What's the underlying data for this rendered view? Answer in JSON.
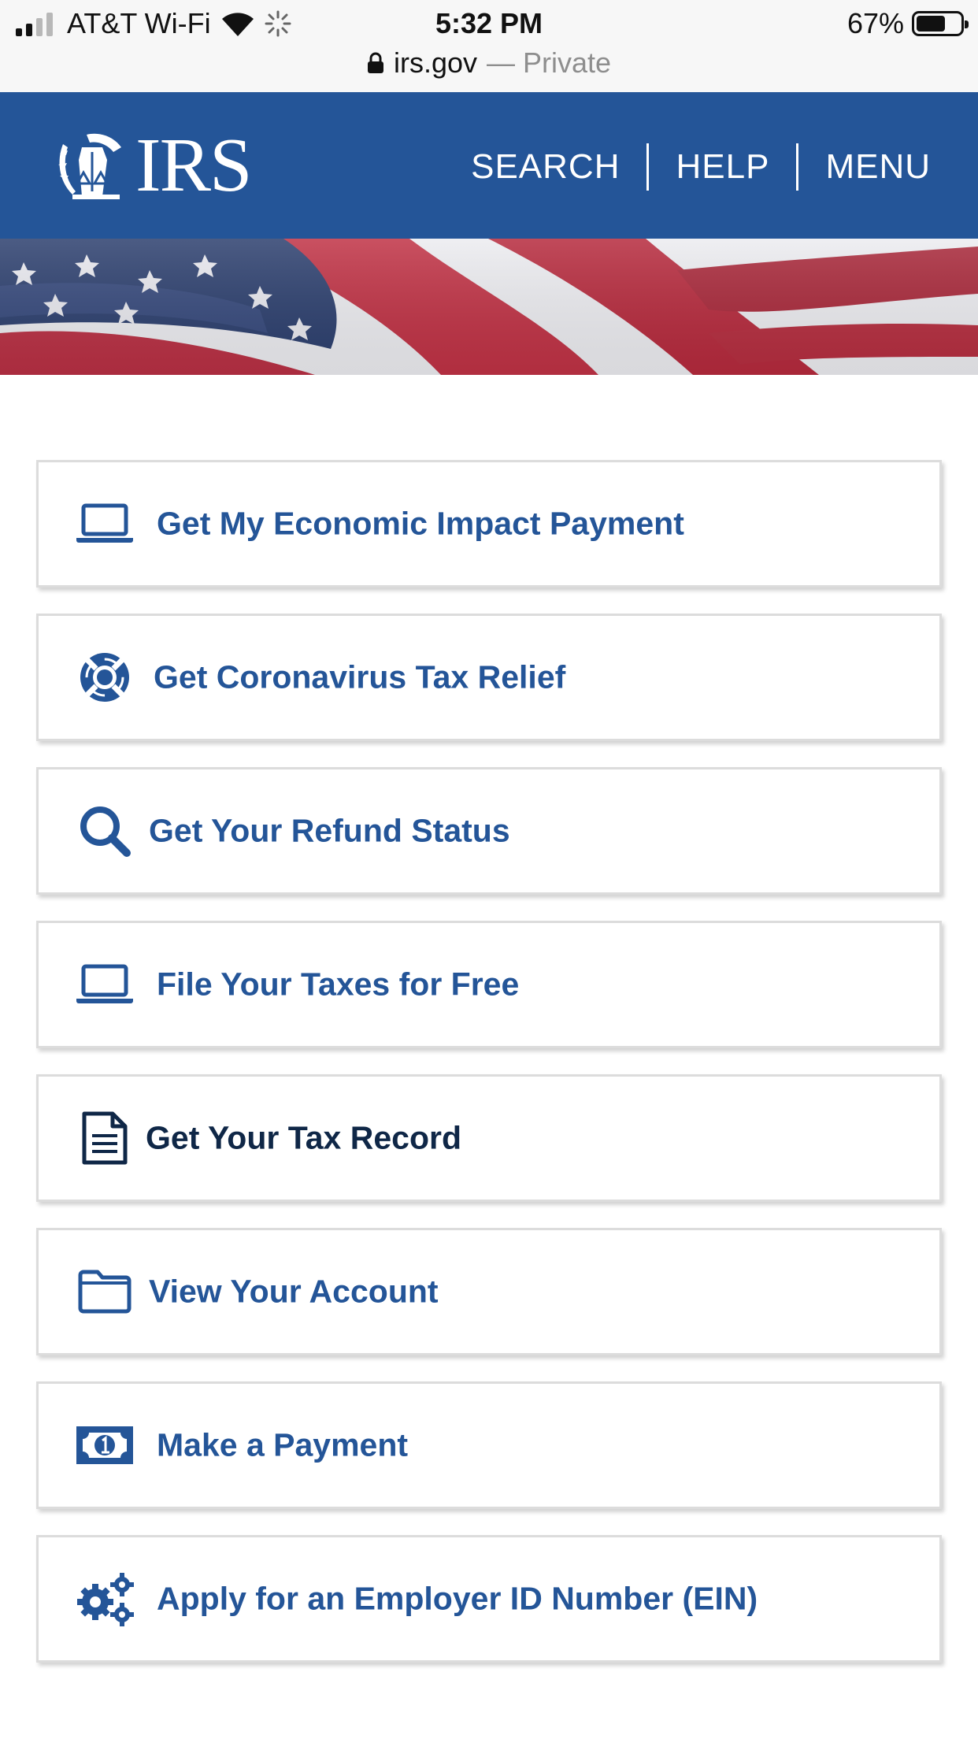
{
  "status_bar": {
    "carrier": "AT&T Wi-Fi",
    "time": "5:32 PM",
    "battery_percent": "67%",
    "battery_level": 0.67
  },
  "url_bar": {
    "domain": "irs.gov",
    "mode": "— Private"
  },
  "header": {
    "logo_text": "IRS",
    "nav": [
      "SEARCH",
      "HELP",
      "MENU"
    ],
    "background_color": "#245598"
  },
  "actions": [
    {
      "label": "Get My Economic Impact Payment",
      "icon": "laptop-icon"
    },
    {
      "label": "Get Coronavirus Tax Relief",
      "icon": "lifebuoy-icon"
    },
    {
      "label": "Get Your Refund Status",
      "icon": "search-icon"
    },
    {
      "label": "File Your Taxes for Free",
      "icon": "laptop-icon"
    },
    {
      "label": "Get Your Tax Record",
      "icon": "document-icon"
    },
    {
      "label": "View Your Account",
      "icon": "folder-icon"
    },
    {
      "label": "Make a Payment",
      "icon": "dollar-bill-icon"
    },
    {
      "label": "Apply for an Employer ID Number (EIN)",
      "icon": "gears-icon"
    }
  ],
  "colors": {
    "accent": "#245598",
    "dark_text": "#0f2747",
    "flag_red": "#b32b3d"
  }
}
